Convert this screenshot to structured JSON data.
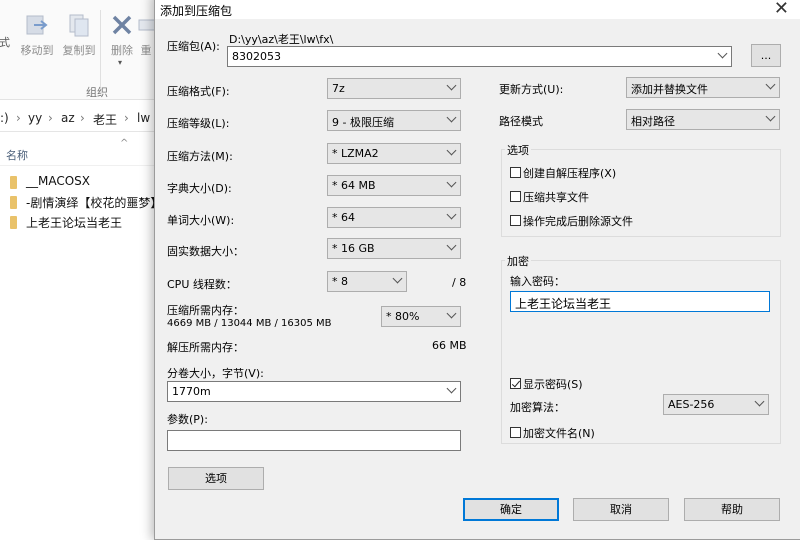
{
  "explorer": {
    "ribbon": {
      "move_to": "移动到",
      "copy_to": "复制到",
      "delete": "删除",
      "rename_partial": "重",
      "left_partial": "式",
      "group_label": "组织"
    },
    "address": {
      "drive": ":)",
      "sep": "›",
      "parts": [
        "yy",
        "az",
        "老王",
        "lw"
      ]
    },
    "column_header": "名称",
    "files": [
      {
        "name": "__MACOSX"
      },
      {
        "name": "-剧情演绎【校花的噩梦】"
      },
      {
        "name": "上老王论坛当老王"
      }
    ]
  },
  "dialog": {
    "title": "添加到压缩包",
    "close_glyph": "✕",
    "archive": {
      "label": "压缩包(A):",
      "path": "D:\\yy\\az\\老王\\lw\\fx\\",
      "value": "8302053",
      "browse": "..."
    },
    "left": {
      "format": {
        "label": "压缩格式(F):",
        "value": "7z"
      },
      "level": {
        "label": "压缩等级(L):",
        "value": "9 - 极限压缩"
      },
      "method": {
        "label": "压缩方法(M):",
        "value": "* LZMA2"
      },
      "dict": {
        "label": "字典大小(D):",
        "value": "* 64 MB"
      },
      "word": {
        "label": "单词大小(W):",
        "value": "* 64"
      },
      "solid": {
        "label": "固实数据大小：",
        "value": "* 16 GB"
      },
      "threads": {
        "label": "CPU 线程数：",
        "value": "* 8",
        "max": "/ 8"
      },
      "mem_compress": {
        "label": "压缩所需内存：",
        "detail": "4669 MB / 13044 MB / 16305 MB",
        "value": "* 80%"
      },
      "mem_decompress": {
        "label": "解压所需内存：",
        "value": "66 MB"
      },
      "volume": {
        "label": "分卷大小，字节(V):",
        "value": "1770m"
      },
      "params": {
        "label": "参数(P):",
        "value": ""
      },
      "options_button": "选项"
    },
    "right": {
      "update": {
        "label": "更新方式(U):",
        "value": "添加并替换文件"
      },
      "path_mode": {
        "label": "路径模式",
        "value": "相对路径"
      },
      "options_group": {
        "title": "选项",
        "sfx": "创建自解压程序(X)",
        "shared": "压缩共享文件",
        "delete_after": "操作完成后删除源文件"
      },
      "encryption_group": {
        "title": "加密",
        "password_label": "输入密码：",
        "password_value": "上老王论坛当老王",
        "show_password": "显示密码(S)",
        "method_label": "加密算法：",
        "method_value": "AES-256",
        "encrypt_names": "加密文件名(N)"
      }
    },
    "buttons": {
      "ok": "确定",
      "cancel": "取消",
      "help": "帮助"
    }
  },
  "colors": {
    "dialog_bg": "#f0f0f0",
    "accent": "#0078d7",
    "folder": "#e9c26a"
  }
}
